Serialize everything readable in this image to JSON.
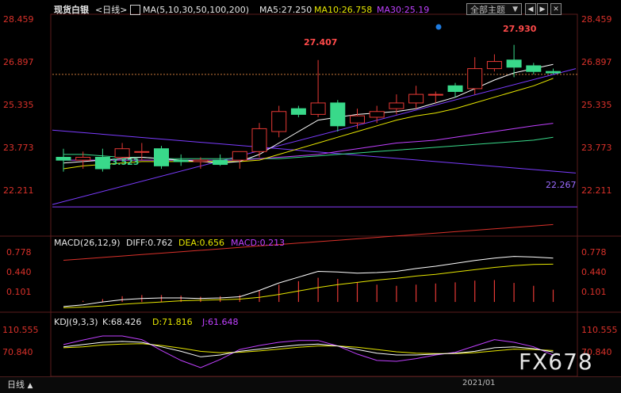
{
  "header": {
    "title": "现货白银",
    "period_label": "<日线>",
    "ma_label": "MA(5,10,30,50,100,200)",
    "ma5": "MA5:27.250",
    "ma10": "MA10:26.758",
    "ma30": "MA30:25.19"
  },
  "theme_selector": {
    "label": "全部主题",
    "value": "全部主题"
  },
  "price_axis": {
    "left": [
      "28.459",
      "26.897",
      "25.335",
      "23.773",
      "22.211"
    ],
    "right": [
      "28.459",
      "26.897",
      "25.335",
      "23.773",
      "22.211"
    ]
  },
  "price_annotations": {
    "high1": "27.407",
    "high2": "27.930",
    "low1": "23.523",
    "support": "22.267"
  },
  "macd": {
    "label": "MACD(26,12,9)",
    "diff": "DIFF:0.762",
    "dea": "DEA:0.656",
    "macd": "MACD:0.213",
    "axis": [
      "0.778",
      "0.440",
      "0.101"
    ]
  },
  "kdj": {
    "label": "KDJ(9,3,3)",
    "k": "K:68.426",
    "d": "D:71.816",
    "j": "J:61.648",
    "axis": [
      "110.555",
      "70.840"
    ]
  },
  "bottom": {
    "tab": "日线",
    "date": "2021/01"
  },
  "watermark": "FX678",
  "colors": {
    "up": "#e53935",
    "down": "#39d98a",
    "ma5": "#ffffff",
    "ma10": "#e6e600",
    "ma30": "#c040ff",
    "ma50": "#39d98a",
    "bg": "#000000",
    "axis": "#d9312a"
  },
  "chart_data": {
    "type": "candlestick",
    "candles": [
      {
        "o": 24.0,
        "h": 24.3,
        "l": 23.5,
        "c": 23.9
      },
      {
        "o": 23.9,
        "h": 24.2,
        "l": 23.6,
        "c": 24.0
      },
      {
        "o": 24.0,
        "h": 24.3,
        "l": 23.5,
        "c": 23.6
      },
      {
        "o": 24.0,
        "h": 24.5,
        "l": 23.9,
        "c": 24.3
      },
      {
        "o": 24.2,
        "h": 24.5,
        "l": 23.9,
        "c": 24.2
      },
      {
        "o": 24.3,
        "h": 24.4,
        "l": 23.6,
        "c": 23.7
      },
      {
        "o": 23.9,
        "h": 24.1,
        "l": 23.7,
        "c": 23.85
      },
      {
        "o": 23.85,
        "h": 24.0,
        "l": 23.6,
        "c": 23.9
      },
      {
        "o": 23.9,
        "h": 24.1,
        "l": 23.7,
        "c": 23.75
      },
      {
        "o": 23.9,
        "h": 24.2,
        "l": 23.6,
        "c": 24.2
      },
      {
        "o": 24.2,
        "h": 25.2,
        "l": 24.0,
        "c": 25.0
      },
      {
        "o": 24.9,
        "h": 25.8,
        "l": 24.7,
        "c": 25.6
      },
      {
        "o": 25.7,
        "h": 25.8,
        "l": 25.4,
        "c": 25.5
      },
      {
        "o": 25.5,
        "h": 27.4,
        "l": 25.4,
        "c": 25.9
      },
      {
        "o": 25.9,
        "h": 26.0,
        "l": 24.9,
        "c": 25.1
      },
      {
        "o": 25.2,
        "h": 25.7,
        "l": 25.0,
        "c": 25.45
      },
      {
        "o": 25.4,
        "h": 25.8,
        "l": 25.2,
        "c": 25.6
      },
      {
        "o": 25.7,
        "h": 26.2,
        "l": 25.5,
        "c": 25.9
      },
      {
        "o": 25.9,
        "h": 26.5,
        "l": 25.7,
        "c": 26.2
      },
      {
        "o": 26.2,
        "h": 26.3,
        "l": 25.9,
        "c": 26.2
      },
      {
        "o": 26.5,
        "h": 26.6,
        "l": 26.1,
        "c": 26.3
      },
      {
        "o": 26.4,
        "h": 27.5,
        "l": 26.2,
        "c": 27.1
      },
      {
        "o": 27.1,
        "h": 27.6,
        "l": 27.0,
        "c": 27.35
      },
      {
        "o": 27.4,
        "h": 27.93,
        "l": 26.8,
        "c": 27.15
      },
      {
        "o": 27.2,
        "h": 27.3,
        "l": 26.9,
        "c": 27.0
      },
      {
        "o": 27.0,
        "h": 27.1,
        "l": 26.9,
        "c": 26.95
      }
    ],
    "ma5": [
      23.8,
      23.85,
      23.9,
      23.95,
      24.0,
      23.95,
      23.9,
      23.85,
      23.8,
      23.85,
      24.1,
      24.5,
      24.9,
      25.3,
      25.4,
      25.5,
      25.55,
      25.6,
      25.7,
      25.9,
      26.1,
      26.4,
      26.7,
      26.95,
      27.1,
      27.25
    ],
    "ma10": [
      23.6,
      23.7,
      23.75,
      23.8,
      23.85,
      23.85,
      23.85,
      23.85,
      23.85,
      23.85,
      23.9,
      24.1,
      24.3,
      24.5,
      24.7,
      24.9,
      25.1,
      25.3,
      25.45,
      25.55,
      25.7,
      25.9,
      26.1,
      26.3,
      26.5,
      26.758
    ],
    "ma30": [
      23.9,
      23.9,
      23.9,
      23.9,
      23.9,
      23.9,
      23.9,
      23.9,
      23.9,
      23.9,
      23.95,
      24.0,
      24.05,
      24.1,
      24.2,
      24.3,
      24.4,
      24.5,
      24.55,
      24.6,
      24.7,
      24.8,
      24.9,
      25.0,
      25.1,
      25.19
    ],
    "ma50": [
      24.1,
      24.1,
      24.05,
      24.0,
      24.0,
      23.95,
      23.95,
      23.95,
      23.95,
      23.95,
      23.95,
      23.95,
      24.0,
      24.05,
      24.1,
      24.15,
      24.2,
      24.25,
      24.3,
      24.35,
      24.4,
      24.45,
      24.5,
      24.55,
      24.6,
      24.7
    ],
    "ma200": [
      20.4,
      20.45,
      20.5,
      20.55,
      20.6,
      20.65,
      20.7,
      20.75,
      20.8,
      20.85,
      20.9,
      20.95,
      21.0,
      21.05,
      21.1,
      21.15,
      21.2,
      21.25,
      21.3,
      21.35,
      21.4,
      21.45,
      21.5,
      21.55,
      21.6,
      21.65
    ],
    "price_range": [
      21.3,
      29.0
    ],
    "trend_upper": {
      "from": [
        0,
        24.95
      ],
      "to": [
        27,
        23.45
      ]
    },
    "trend_lower": {
      "from": [
        0,
        22.35
      ],
      "to": [
        27,
        27.1
      ]
    },
    "support_line": 22.267,
    "ref_line": 26.897,
    "macd_hist": [
      0.0,
      0.02,
      0.05,
      0.1,
      0.12,
      0.12,
      0.11,
      0.09,
      0.1,
      0.12,
      0.2,
      0.3,
      0.36,
      0.42,
      0.4,
      0.34,
      0.3,
      0.28,
      0.3,
      0.32,
      0.34,
      0.37,
      0.38,
      0.33,
      0.28,
      0.213
    ],
    "macd_diff": [
      -0.08,
      -0.05,
      0.0,
      0.04,
      0.06,
      0.07,
      0.07,
      0.06,
      0.07,
      0.09,
      0.2,
      0.33,
      0.43,
      0.53,
      0.52,
      0.5,
      0.51,
      0.53,
      0.58,
      0.62,
      0.67,
      0.72,
      0.76,
      0.79,
      0.78,
      0.762
    ],
    "macd_dea": [
      -0.1,
      -0.09,
      -0.07,
      -0.04,
      -0.02,
      0.0,
      0.02,
      0.03,
      0.04,
      0.05,
      0.08,
      0.13,
      0.19,
      0.25,
      0.3,
      0.34,
      0.38,
      0.41,
      0.45,
      0.48,
      0.52,
      0.56,
      0.6,
      0.63,
      0.65,
      0.656
    ],
    "macd_range": [
      -0.15,
      0.95
    ],
    "kdj_k": [
      80,
      85,
      90,
      92,
      90,
      80,
      70,
      58,
      62,
      70,
      75,
      80,
      84,
      86,
      82,
      74,
      66,
      62,
      62,
      64,
      66,
      70,
      78,
      80,
      76,
      68.4
    ],
    "kdj_d": [
      78,
      80,
      84,
      86,
      87,
      83,
      77,
      70,
      67,
      68,
      71,
      75,
      79,
      82,
      82,
      79,
      74,
      69,
      66,
      65,
      65,
      67,
      71,
      75,
      74,
      71.8
    ],
    "kdj_j": [
      85,
      95,
      104,
      104,
      96,
      72,
      50,
      34,
      52,
      74,
      83,
      90,
      94,
      94,
      82,
      64,
      50,
      48,
      54,
      62,
      68,
      82,
      96,
      90,
      80,
      61.6
    ],
    "kdj_range": [
      20,
      125
    ]
  }
}
